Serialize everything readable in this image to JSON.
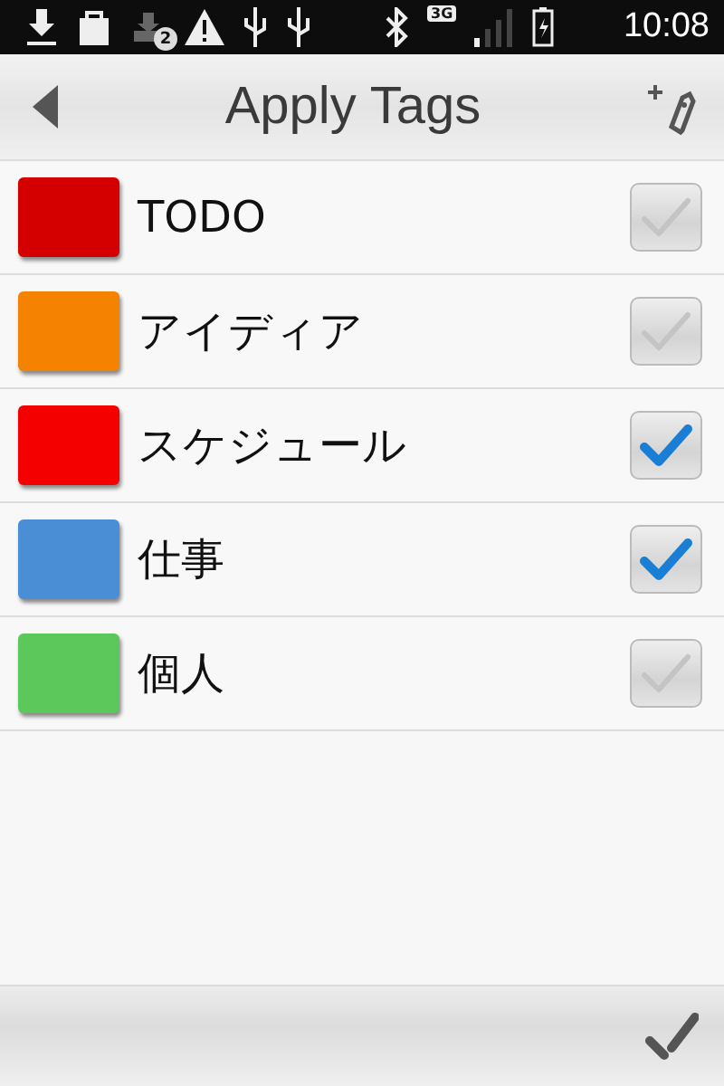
{
  "status_bar": {
    "notification_count": "2",
    "network": "3G",
    "time": "10:08"
  },
  "header": {
    "title": "Apply Tags"
  },
  "tags": [
    {
      "name": "TODO",
      "color": "#d40000",
      "checked": false
    },
    {
      "name": "アイディア",
      "color": "#f58200",
      "checked": false
    },
    {
      "name": "スケジュール",
      "color": "#f50000",
      "checked": true
    },
    {
      "name": "仕事",
      "color": "#4a8fd6",
      "checked": true
    },
    {
      "name": "個人",
      "color": "#5cc75a",
      "checked": false
    }
  ]
}
